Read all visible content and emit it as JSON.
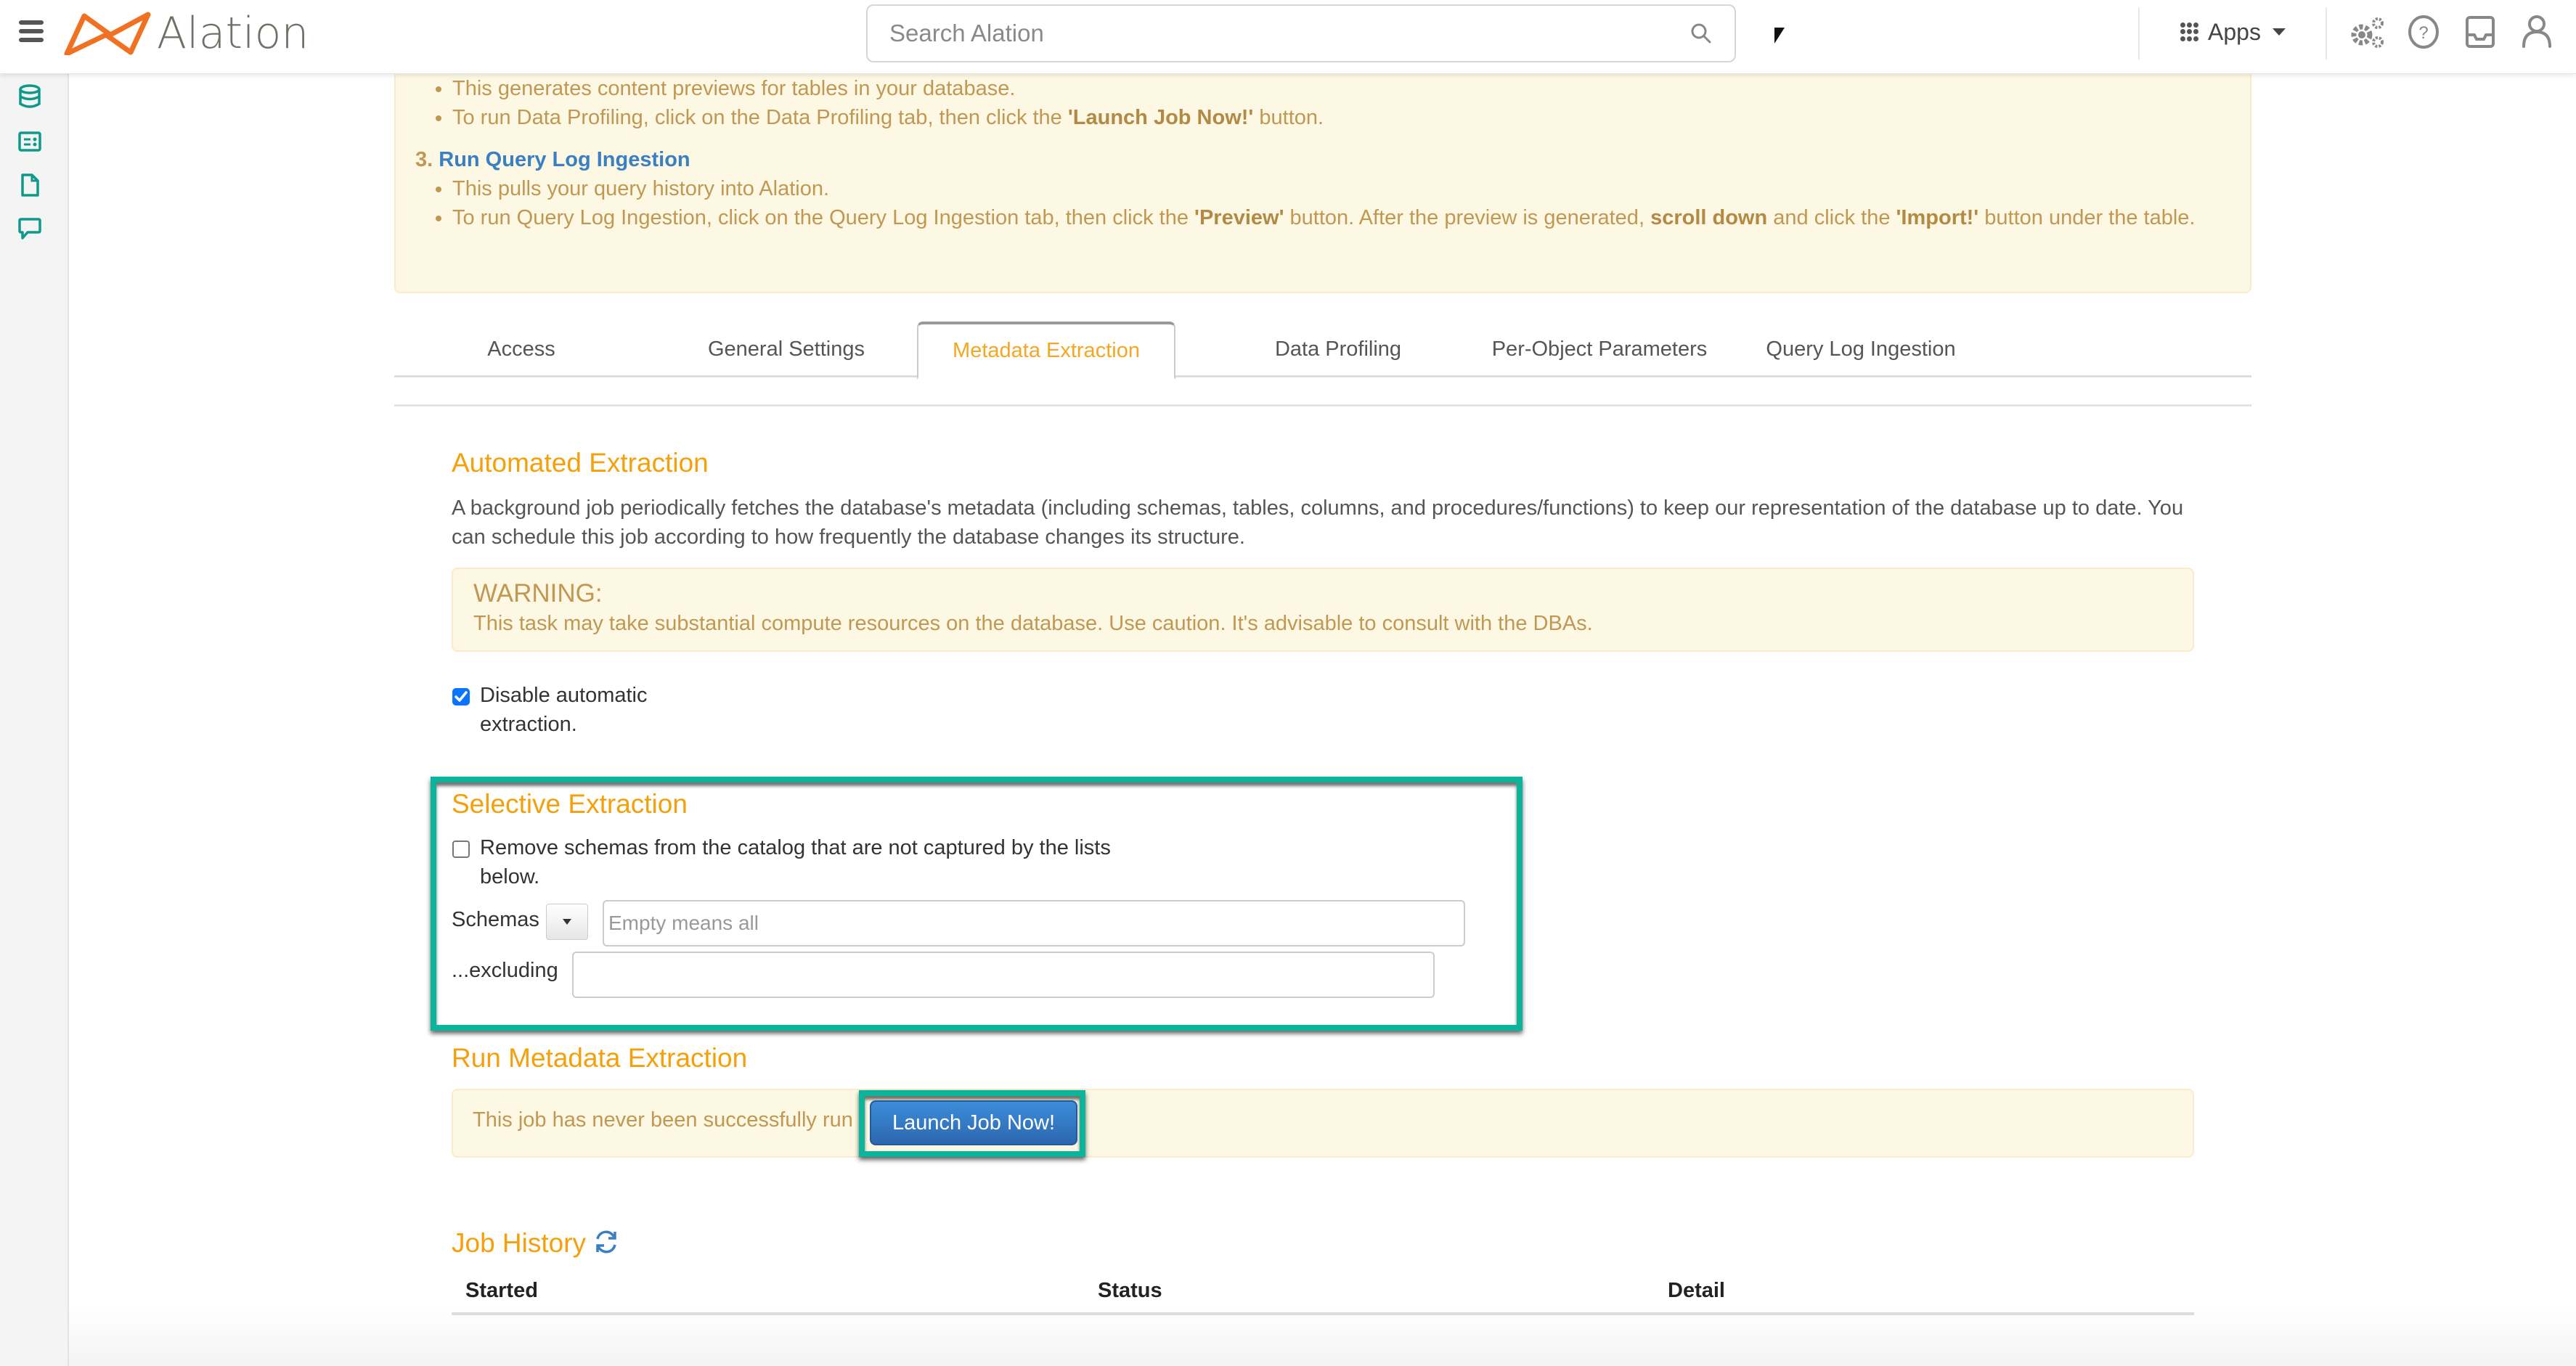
{
  "nav": {
    "brand": "Alation",
    "search_placeholder": "Search Alation",
    "apps_label": "Apps",
    "icons": [
      "menu-icon",
      "search-icon",
      "apps-grid-icon",
      "settings-gears-icon",
      "help-icon",
      "inbox-icon",
      "user-icon"
    ]
  },
  "sidebar": {
    "icons": [
      "database-icon",
      "catalog-card-icon",
      "document-icon",
      "conversation-icon"
    ]
  },
  "instructions": {
    "step2_bullets": [
      "This generates content previews for tables in your database.",
      {
        "before": "To run Data Profiling, click on the Data Profiling tab, then click the ",
        "bold": "'Launch Job Now!'",
        "after": " button."
      }
    ],
    "step3_number": "3.",
    "step3_title": "Run Query Log Ingestion",
    "step3_bullet1": "This pulls your query history into Alation.",
    "step3_bullet2": {
      "p1": "To run Query Log Ingestion, click on the Query Log Ingestion tab, then click the ",
      "b1": "'Preview'",
      "p2": " button. After the preview is generated, ",
      "b2": "scroll down",
      "p3": " and click the ",
      "b3": "'Import!'",
      "p4": " button under the table."
    }
  },
  "tabs": [
    {
      "label": "Access",
      "active": false
    },
    {
      "label": "General Settings",
      "active": false
    },
    {
      "label": "Metadata Extraction",
      "active": true
    },
    {
      "label": "Data Profiling",
      "active": false
    },
    {
      "label": "Per-Object Parameters",
      "active": false
    },
    {
      "label": "Query Log Ingestion",
      "active": false
    }
  ],
  "automated": {
    "title": "Automated Extraction",
    "description": "A background job periodically fetches the database's metadata (including schemas, tables, columns, and procedures/functions) to keep our representation of the database up to date. You can schedule this job according to how frequently the database changes its structure.",
    "warning_title": "WARNING:",
    "warning_text": "This task may take substantial compute resources on the database. Use caution. It's advisable to consult with the DBAs.",
    "disable_checkbox_label": "Disable automatic extraction.",
    "disable_checked": true
  },
  "selective": {
    "title": "Selective Extraction",
    "remove_checkbox_label": "Remove schemas from the catalog that are not captured by the lists below.",
    "remove_checked": false,
    "schemas_label": "Schemas",
    "schemas_placeholder": "Empty means all",
    "schemas_value": "",
    "excluding_label": "...excluding",
    "excluding_value": ""
  },
  "run": {
    "title": "Run Metadata Extraction",
    "status_text": "This job has never been successfully run",
    "launch_label": "Launch Job Now!"
  },
  "history": {
    "title": "Job History",
    "columns": [
      "Started",
      "Status",
      "Detail"
    ],
    "rows": []
  },
  "colors": {
    "accent_orange": "#f5a00a",
    "brand_orange": "#f07122",
    "link_blue": "#3a7fc1",
    "highlight_teal": "#0ab59c",
    "alert_bg": "#fcf8e3",
    "alert_text": "#c09853",
    "sidebar_icon_teal": "#0e9a8a",
    "button_blue": "#2c67ae"
  }
}
